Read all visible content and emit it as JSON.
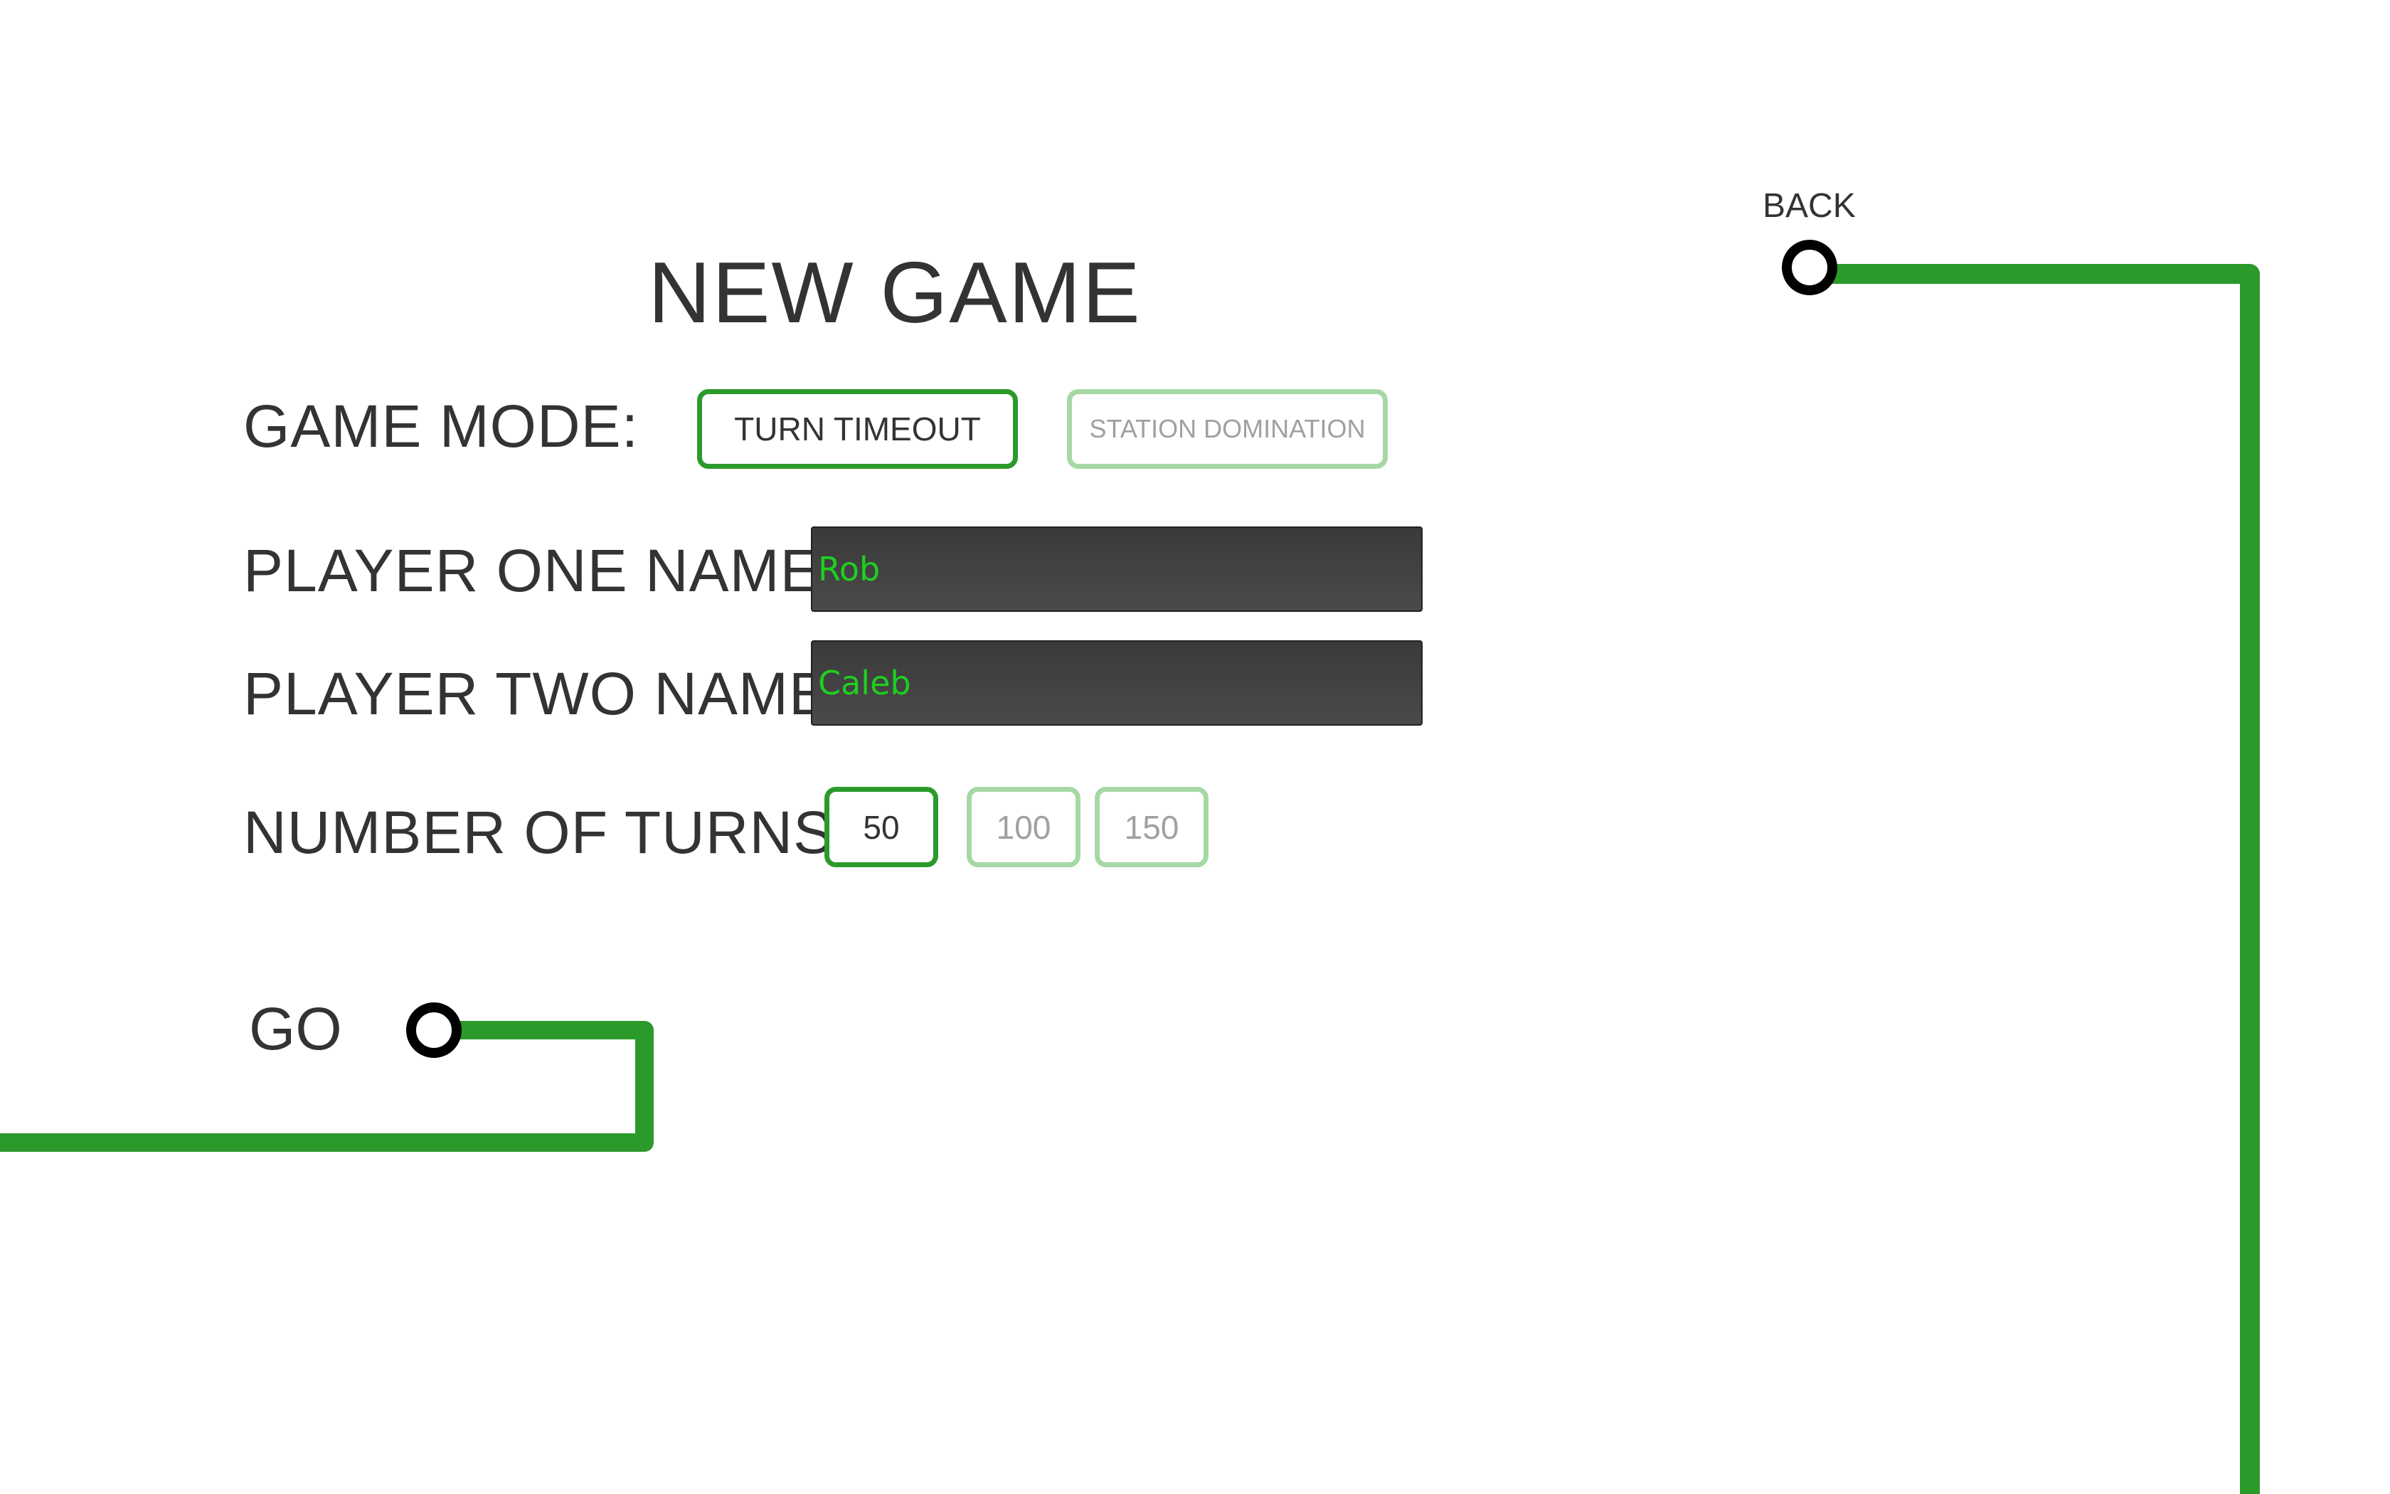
{
  "screen": {
    "title": "NEW GAME"
  },
  "navigation": {
    "back_label": "BACK",
    "go_label": "GO"
  },
  "game_mode": {
    "label": "GAME MODE:",
    "options": [
      {
        "label": "TURN TIMEOUT",
        "selected": true
      },
      {
        "label": "STATION DOMINATION",
        "selected": false
      }
    ]
  },
  "player_one": {
    "label": "PLAYER ONE NAME:",
    "value": "Rob"
  },
  "player_two": {
    "label": "PLAYER TWO NAME:",
    "value": "Caleb"
  },
  "turns": {
    "label": "NUMBER OF TURNS:",
    "options": [
      {
        "label": "50",
        "selected": true
      },
      {
        "label": "100",
        "selected": false
      },
      {
        "label": "150",
        "selected": false
      }
    ]
  },
  "colors": {
    "track_green": "#2b9a2b",
    "inactive_border": "#a6d8a6",
    "input_text": "#1fcf1f",
    "station_ring": "#000000"
  },
  "icons": {
    "station": "station-icon"
  }
}
